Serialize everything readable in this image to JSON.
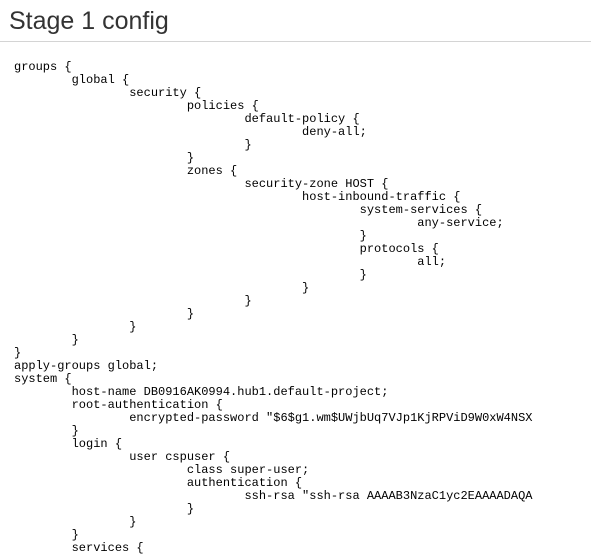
{
  "header": {
    "title": "Stage 1 config"
  },
  "config": {
    "text": "groups {\n\tglobal {\n\t\tsecurity {\n\t\t\tpolicies {\n\t\t\t\tdefault-policy {\n\t\t\t\t\tdeny-all;\n\t\t\t\t}\n\t\t\t}\n\t\t\tzones {\n\t\t\t\tsecurity-zone HOST {\n\t\t\t\t\thost-inbound-traffic {\n\t\t\t\t\t\tsystem-services {\n\t\t\t\t\t\t\tany-service;\n\t\t\t\t\t\t}\n\t\t\t\t\t\tprotocols {\n\t\t\t\t\t\t\tall;\n\t\t\t\t\t\t}\n\t\t\t\t\t}\n\t\t\t\t}\n\t\t\t}\n\t\t}\n\t}\n}\napply-groups global;\nsystem {\n\thost-name DB0916AK0994.hub1.default-project;\n\troot-authentication {\n\t\tencrypted-password \"$6$g1.wm$UWjbUq7VJp1KjRPViD9W0xW4NSX\n\t}\n\tlogin {\n\t\tuser cspuser {\n\t\t\tclass super-user;\n\t\t\tauthentication {\n\t\t\t\tssh-rsa \"ssh-rsa AAAAB3NzaC1yc2EAAAADAQA\n\t\t\t}\n\t\t}\n\t}\n\tservices {"
  }
}
